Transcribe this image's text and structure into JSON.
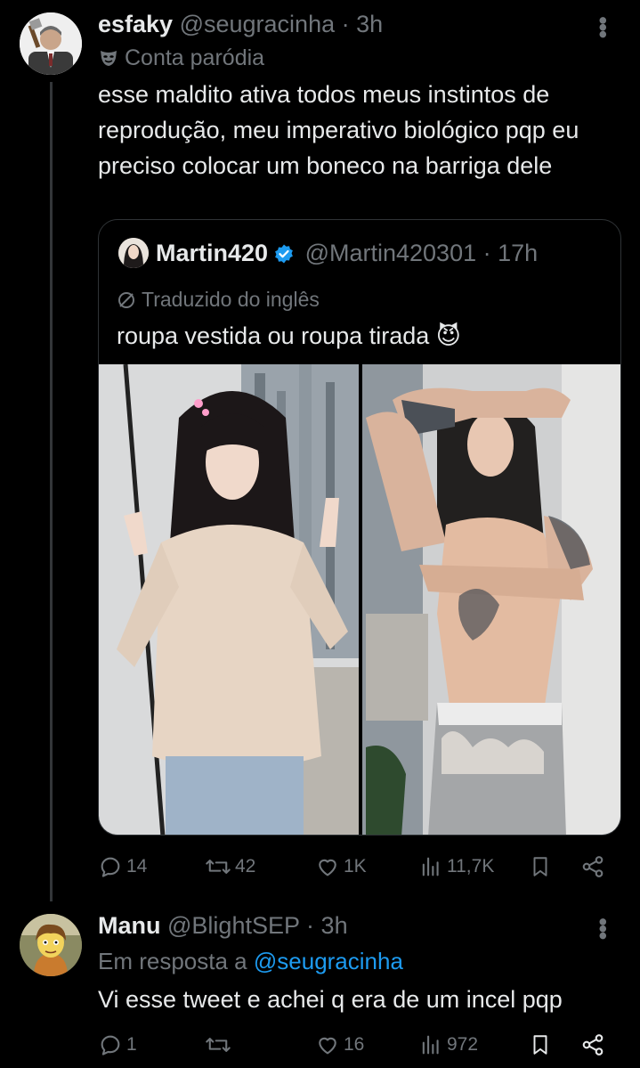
{
  "colors": {
    "background": "#000000",
    "text": "#e7e9ea",
    "muted": "#71767b",
    "accent": "#1d9bf0",
    "border": "#2f3336"
  },
  "post": {
    "author_name": "esfaky",
    "handle": "@seugracinha",
    "sep": "·",
    "time": "3h",
    "parody_icon": "mask-icon",
    "parody_label": "Conta paródia",
    "text": "esse maldito ativa todos meus instintos de reprodução, meu imperativo biológico pqp eu preciso colocar um boneco na barriga dele",
    "quote": {
      "author_name": "Martin420",
      "verified_icon": "verified-badge-icon",
      "handle": "@Martin420301",
      "sep": "·",
      "time": "17h",
      "translated_label": "Traduzido do inglês",
      "text": "roupa vestida ou roupa tirada 😈"
    },
    "stats": {
      "replies": "14",
      "reposts": "42",
      "likes": "1K",
      "views": "11,7K"
    }
  },
  "reply": {
    "author_name": "Manu",
    "handle": "@BlightSEP",
    "sep": "·",
    "time": "3h",
    "in_reply_prefix": "Em resposta a",
    "in_reply_handle": "@seugracinha",
    "text": "Vi esse tweet e achei q era de um incel pqp",
    "stats": {
      "replies": "1",
      "reposts": "",
      "likes": "16",
      "views": "972"
    }
  }
}
